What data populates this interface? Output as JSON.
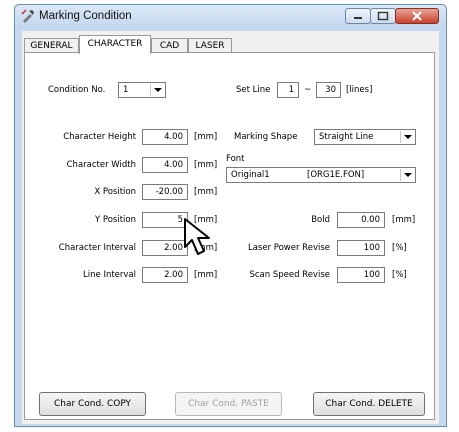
{
  "window": {
    "title": "Marking Condition"
  },
  "tabs": [
    "GENERAL",
    "CHARACTER",
    "CAD",
    "LASER"
  ],
  "active_tab": "CHARACTER",
  "condition": {
    "label": "Condition No.",
    "value": "1"
  },
  "set_line": {
    "label": "Set Line",
    "from": "1",
    "sep": "~",
    "to": "30",
    "unit": "[lines]"
  },
  "left_fields": [
    {
      "label": "Character Height",
      "value": "4.00",
      "unit": "[mm]"
    },
    {
      "label": "Character Width",
      "value": "4.00",
      "unit": "[mm]"
    },
    {
      "label": "X Position",
      "value": "-20.00",
      "unit": "[mm]"
    },
    {
      "label": "Y Position",
      "value": "5",
      "unit": "[mm]"
    },
    {
      "label": "Character Interval",
      "value": "2.00",
      "unit": "[mm]"
    },
    {
      "label": "Line Interval",
      "value": "2.00",
      "unit": "[mm]"
    }
  ],
  "marking_shape": {
    "label": "Marking Shape",
    "value": "Straight Line"
  },
  "font": {
    "label": "Font",
    "name": "Original1",
    "file": "[ORG1E.FON]"
  },
  "right_fields": [
    {
      "label": "Bold",
      "value": "0.00",
      "unit": "[mm]"
    },
    {
      "label": "Laser Power Revise",
      "value": "100",
      "unit": "[%]"
    },
    {
      "label": "Scan Speed Revise",
      "value": "100",
      "unit": "[%]"
    }
  ],
  "buttons": {
    "copy": "Char Cond. COPY",
    "paste": "Char Cond. PASTE",
    "delete": "Char Cond. DELETE"
  }
}
